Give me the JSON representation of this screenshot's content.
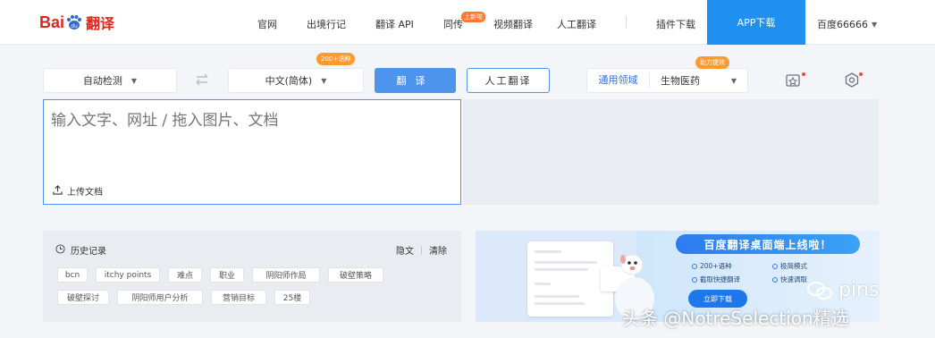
{
  "header": {
    "logo_bai": "Bai",
    "logo_text": "翻译",
    "nav": [
      "官网",
      "出境行记",
      "翻译 API",
      "同传",
      "视频翻译",
      "人工翻译",
      "插件下载"
    ],
    "nav_badge": "上新啦",
    "app_download": "APP下载",
    "user": "百度66666"
  },
  "toolbar": {
    "source_lang": "自动检测",
    "target_lang": "中文(简体)",
    "target_badge": "200+语种",
    "translate_label": "翻译",
    "human_translate_label": "人工翻译",
    "domain_label": "通用领域",
    "domain_value": "生物医药",
    "domain_badge": "助力提效"
  },
  "editor": {
    "placeholder": "输入文字、网址 / 拖入图片、文档",
    "upload_label": "上传文档"
  },
  "history": {
    "title": "历史记录",
    "action_collapse": "隐文",
    "action_clear": "清除",
    "chips": [
      "bcn",
      "itchy points",
      "难点",
      "职业",
      "阴阳师作局",
      "破壁策略",
      "破壁探讨",
      "阴阳师用户分析",
      "营销目标",
      "25楼"
    ]
  },
  "banner": {
    "title": "百度翻译桌面端上线啦！",
    "features": [
      "200+语种",
      "极简模式",
      "截取快捷翻译",
      "快速调取"
    ],
    "cta": "立即下载"
  },
  "watermark": {
    "brand": "pins",
    "credit": "头条 @NotreSelection精选"
  },
  "colors": {
    "primary": "#4d94ee",
    "app_download_bg": "#1f8ff0",
    "badge_orange": "#ff9a2e",
    "logo_red": "#e1251b"
  }
}
